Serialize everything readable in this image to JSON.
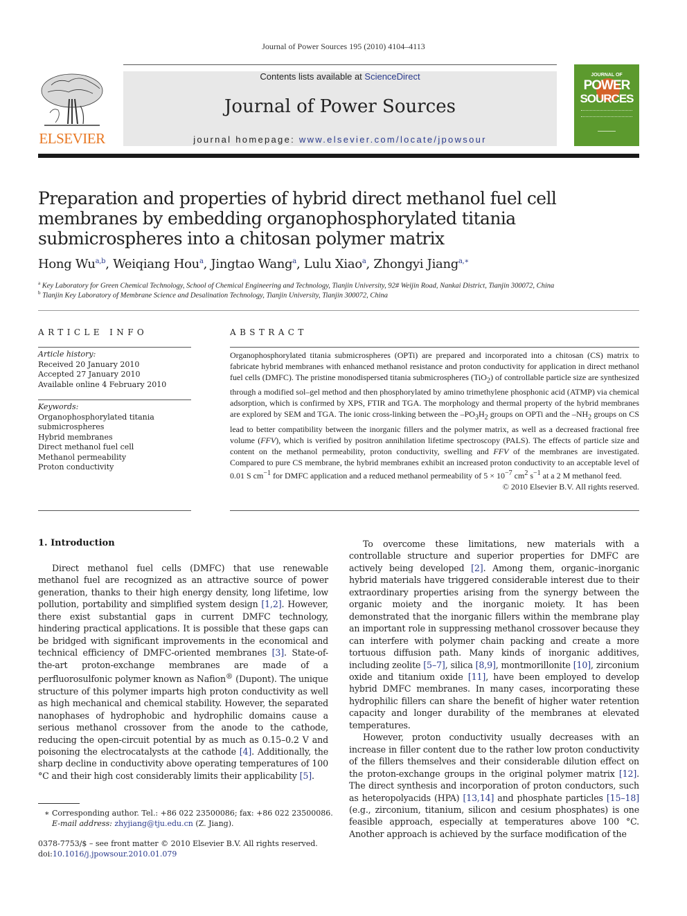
{
  "header": {
    "citation": "Journal of Power Sources 195 (2010) 4104–4113",
    "contents_prefix": "Contents lists available at ",
    "contents_link": "ScienceDirect",
    "journal_title": "Journal of Power Sources",
    "homepage_prefix": "journal homepage: ",
    "homepage_link": "www.elsevier.com/locate/jpowsour",
    "publisher_logo_text": "ELSEVIER",
    "cover": {
      "line1": "JOURNAL OF",
      "line2": "POWER",
      "line3": "SOURCES",
      "bg_color": "#5c9a2e",
      "accent_color": "#d4622a"
    }
  },
  "article": {
    "title": "Preparation and properties of hybrid direct methanol fuel cell membranes by embedding organophosphorylated titania submicrospheres into a chitosan polymer matrix",
    "authors": [
      {
        "name": "Hong Wu",
        "sup": "a,b"
      },
      {
        "name": "Weiqiang Hou",
        "sup": "a"
      },
      {
        "name": "Jingtao Wang",
        "sup": "a"
      },
      {
        "name": "Lulu Xiao",
        "sup": "a"
      },
      {
        "name": "Zhongyi Jiang",
        "sup": "a,∗"
      }
    ],
    "affiliations": [
      {
        "sup": "a",
        "text": "Key Laboratory for Green Chemical Technology, School of Chemical Engineering and Technology, Tianjin University, 92# Weijin Road, Nankai District, Tianjin 300072, China"
      },
      {
        "sup": "b",
        "text": "Tianjin Key Laboratory of Membrane Science and Desalination Technology, Tianjin University, Tianjin 300072, China"
      }
    ]
  },
  "article_info": {
    "heading": "ARTICLE INFO",
    "history_label": "Article history:",
    "history": [
      "Received 20 January 2010",
      "Accepted 27 January 2010",
      "Available online 4 February 2010"
    ],
    "keywords_label": "Keywords:",
    "keywords": [
      "Organophosphorylated titania",
      "submicrospheres",
      "Hybrid membranes",
      "Direct methanol fuel cell",
      "Methanol permeability",
      "Proton conductivity"
    ]
  },
  "abstract": {
    "heading": "ABSTRACT",
    "p1": "Organophosphorylated titania submicrospheres (OPTi) are prepared and incorporated into a chitosan (CS) matrix to fabricate hybrid membranes with enhanced methanol resistance and proton conductivity for application in direct methanol fuel cells (DMFC). The pristine monodispersed titania submicrospheres (TiO",
    "p2": ") of controllable particle size are synthesized through a modified sol–gel method and then phosphorylated by amino trimethylene phosphonic acid (ATMP) via chemical adsorption, which is confirmed by XPS, FTIR and TGA. The morphology and thermal property of the hybrid membranes are explored by SEM and TGA. The ionic cross-linking between the –PO",
    "p3": "H",
    "p4": " groups on OPTi and the –NH",
    "p5": " groups on CS lead to better compatibility between the inorganic fillers and the polymer matrix, as well as a decreased fractional free volume (",
    "ffv": "FFV",
    "p6": "), which is verified by positron annihilation lifetime spectroscopy (PALS). The effects of particle size and content on the methanol permeability, proton conductivity, swelling and ",
    "p7": " of the membranes are investigated. Compared to pure CS membrane, the hybrid membranes exhibit an increased proton conductivity to an acceptable level of 0.01 S cm",
    "p8": " for DMFC application and a reduced methanol permeability of 5 × 10",
    "p9": " cm",
    "p10": " s",
    "p11": " at a 2 M methanol feed.",
    "sub2": "2",
    "sub3": "3",
    "sup_m1": "−1",
    "sup_m7": "−7",
    "sup_2": "2",
    "copyright": "© 2010 Elsevier B.V. All rights reserved."
  },
  "introduction": {
    "heading": "1.  Introduction",
    "left_p1_a": "Direct methanol fuel cells (DMFC) that use renewable methanol fuel are recognized as an attractive source of power generation, thanks to their high energy density, long lifetime, low pollution, portability and simplified system design ",
    "ref_1_2": "[1,2]",
    "left_p1_b": ". However, there exist substantial gaps in current DMFC technology, hindering practical applications. It is possible that these gaps can be bridged with significant improvements in the economical and technical efficiency of DMFC-oriented membranes ",
    "ref_3": "[3]",
    "left_p1_c": ". State-of-the-art proton-exchange membranes are made of a perfluorosulfonic polymer known as Nafion",
    "reg": "®",
    "left_p1_d": " (Dupont). The unique structure of this polymer imparts high proton conductivity as well as high mechanical and chemical stability. However, the separated nanophases of hydrophobic and hydrophilic domains cause a serious methanol crossover from the anode to the cathode, reducing the open-circuit potential by as much as 0.15–0.2 V and poisoning the electrocatalysts at the cathode ",
    "ref_4": "[4]",
    "left_p1_e": ". Additionally, the sharp decline in conductivity above operating temperatures of 100 °C and their high cost considerably limits their applicability ",
    "ref_5": "[5]",
    "left_p1_f": ".",
    "right_p1_a": "To overcome these limitations, new materials with a controllable structure and superior properties for DMFC are actively being developed ",
    "ref_2": "[2]",
    "right_p1_b": ". Among them, organic–inorganic hybrid materials have triggered considerable interest due to their extraordinary properties arising from the synergy between the organic moiety and the inorganic moiety. It has been demonstrated that the inorganic fillers within the membrane play an important role in suppressing methanol crossover because they can interfere with polymer chain packing and create a more tortuous diffusion path. Many kinds of inorganic additives, including zeolite ",
    "ref_5_7": "[5–7]",
    "right_p1_c": ", silica ",
    "ref_8_9": "[8,9]",
    "right_p1_d": ", montmorillonite ",
    "ref_10": "[10]",
    "right_p1_e": ", zirconium oxide and titanium oxide ",
    "ref_11": "[11]",
    "right_p1_f": ", have been employed to develop hybrid DMFC membranes. In many cases, incorporating these hydrophilic fillers can share the benefit of higher water retention capacity and longer durability of the membranes at elevated temperatures.",
    "right_p2_a": "However, proton conductivity usually decreases with an increase in filler content due to the rather low proton conductivity of the fillers themselves and their considerable dilution effect on the proton-exchange groups in the original polymer matrix ",
    "ref_12": "[12]",
    "right_p2_b": ". The direct synthesis and incorporation of proton conductors, such as heteropolyacids (HPA) ",
    "ref_13_14": "[13,14]",
    "right_p2_c": " and phosphate particles ",
    "ref_15_18": "[15–18]",
    "right_p2_d": " (e.g., zirconium, titanium, silicon and cesium phosphates) is one feasible approach, especially at temperatures above 100 °C. Another approach is achieved by the surface modification of the"
  },
  "footnotes": {
    "corresponding": "∗  Corresponding author. Tel.: +86 022 23500086; fax: +86 022 23500086.",
    "email_label": "E-mail address: ",
    "email": "zhyjiang@tju.edu.cn",
    "email_suffix": " (Z. Jiang).",
    "issn": "0378-7753/$ – see front matter © 2010 Elsevier B.V. All rights reserved.",
    "doi_label": "doi:",
    "doi": "10.1016/j.jpowsour.2010.01.079"
  }
}
